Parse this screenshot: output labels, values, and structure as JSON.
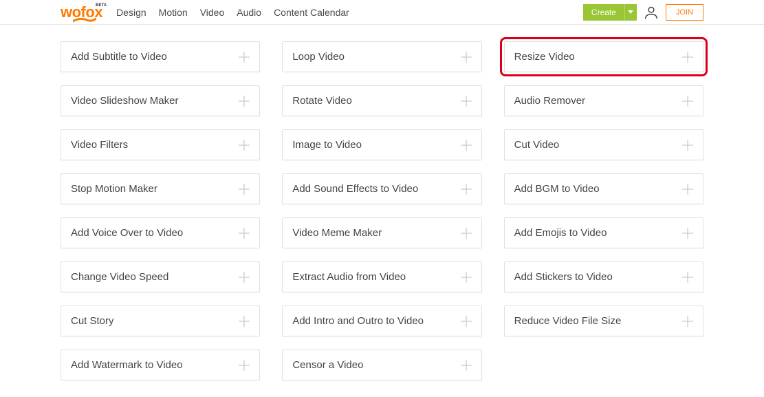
{
  "header": {
    "logo": {
      "text": "wofox",
      "beta": "BETA"
    },
    "nav": [
      "Design",
      "Motion",
      "Video",
      "Audio",
      "Content Calendar"
    ],
    "create_label": "Create",
    "join_label": "JOIN"
  },
  "cards": [
    {
      "label": "Add Subtitle to Video",
      "name": "card-add-subtitle",
      "highlighted": false
    },
    {
      "label": "Loop Video",
      "name": "card-loop-video",
      "highlighted": false
    },
    {
      "label": "Resize Video",
      "name": "card-resize-video",
      "highlighted": true
    },
    {
      "label": "Video Slideshow Maker",
      "name": "card-slideshow-maker",
      "highlighted": false
    },
    {
      "label": "Rotate Video",
      "name": "card-rotate-video",
      "highlighted": false
    },
    {
      "label": "Audio Remover",
      "name": "card-audio-remover",
      "highlighted": false
    },
    {
      "label": "Video Filters",
      "name": "card-video-filters",
      "highlighted": false
    },
    {
      "label": "Image to Video",
      "name": "card-image-to-video",
      "highlighted": false
    },
    {
      "label": "Cut Video",
      "name": "card-cut-video",
      "highlighted": false
    },
    {
      "label": "Stop Motion Maker",
      "name": "card-stop-motion",
      "highlighted": false
    },
    {
      "label": "Add Sound Effects to Video",
      "name": "card-sound-effects",
      "highlighted": false
    },
    {
      "label": "Add BGM to Video",
      "name": "card-bgm",
      "highlighted": false
    },
    {
      "label": "Add Voice Over to Video",
      "name": "card-voice-over",
      "highlighted": false
    },
    {
      "label": "Video Meme Maker",
      "name": "card-meme-maker",
      "highlighted": false
    },
    {
      "label": "Add Emojis to Video",
      "name": "card-emojis",
      "highlighted": false
    },
    {
      "label": "Change Video Speed",
      "name": "card-change-speed",
      "highlighted": false
    },
    {
      "label": "Extract Audio from Video",
      "name": "card-extract-audio",
      "highlighted": false
    },
    {
      "label": "Add Stickers to Video",
      "name": "card-stickers",
      "highlighted": false
    },
    {
      "label": "Cut Story",
      "name": "card-cut-story",
      "highlighted": false
    },
    {
      "label": "Add Intro and Outro to Video",
      "name": "card-intro-outro",
      "highlighted": false
    },
    {
      "label": "Reduce Video File Size",
      "name": "card-reduce-size",
      "highlighted": false
    },
    {
      "label": "Add Watermark to Video",
      "name": "card-watermark",
      "highlighted": false
    },
    {
      "label": "Censor a Video",
      "name": "card-censor",
      "highlighted": false
    }
  ]
}
